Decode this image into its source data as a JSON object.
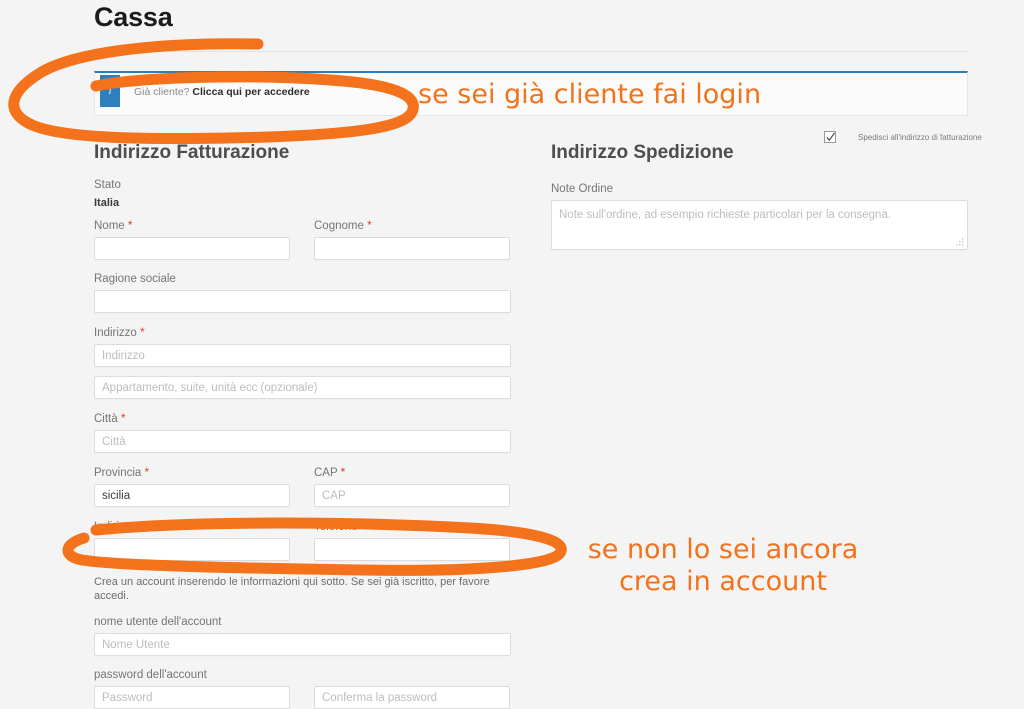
{
  "page": {
    "title": "Cassa"
  },
  "notice": {
    "icon": "info-icon",
    "icon_glyph": "i",
    "prefix": "Già cliente?",
    "link": "Clicca qui per accedere"
  },
  "ship_to_billing": {
    "label": "Spedisci all'indirizzo di fatturazione",
    "checked": true
  },
  "billing": {
    "heading": "Indirizzo Fatturazione",
    "country_label": "Stato",
    "country_value": "Italia",
    "first_name_label": "Nome",
    "first_name_value": "",
    "first_name_placeholder": "",
    "last_name_label": "Cognome",
    "last_name_value": "",
    "last_name_placeholder": "",
    "company_label": "Ragione sociale",
    "company_value": "",
    "company_placeholder": "",
    "address_label": "Indirizzo",
    "address_placeholder": "Indirizzo",
    "address_value": "",
    "address2_placeholder": "Appartamento, suite, unità ecc (opzionale)",
    "address2_value": "",
    "city_label": "Città",
    "city_placeholder": "Città",
    "city_value": "",
    "state_label": "Provincia",
    "state_value": "sicilia",
    "postcode_label": "CAP",
    "postcode_placeholder": "CAP",
    "postcode_value": "",
    "email_label": "Indirizzo email",
    "email_value": "",
    "email_placeholder": "",
    "phone_label": "Telefono",
    "phone_value": "",
    "phone_placeholder": "",
    "required_mark": "*"
  },
  "account": {
    "note": "Crea un account inserendo le informazioni qui sotto. Se sei già iscritto, per favore accedi.",
    "username_label": "nome utente dell'account",
    "username_placeholder": "Nome Utente",
    "username_value": "",
    "password_label": "password dell'account",
    "password_placeholder": "Password",
    "password_value": "",
    "password_confirm_placeholder": "Conferma la password",
    "password_confirm_value": ""
  },
  "shipping": {
    "heading": "Indirizzo Spedizione",
    "notes_label": "Note Ordine",
    "notes_placeholder": "Note sull'ordine, ad esempio richieste particolari per la consegna.",
    "notes_value": ""
  },
  "annotations": {
    "login_note": "se sei già cliente fai login",
    "account_note_line1": "se non lo sei ancora",
    "account_note_line2": "crea in account",
    "ink_color": "#f4721b"
  }
}
